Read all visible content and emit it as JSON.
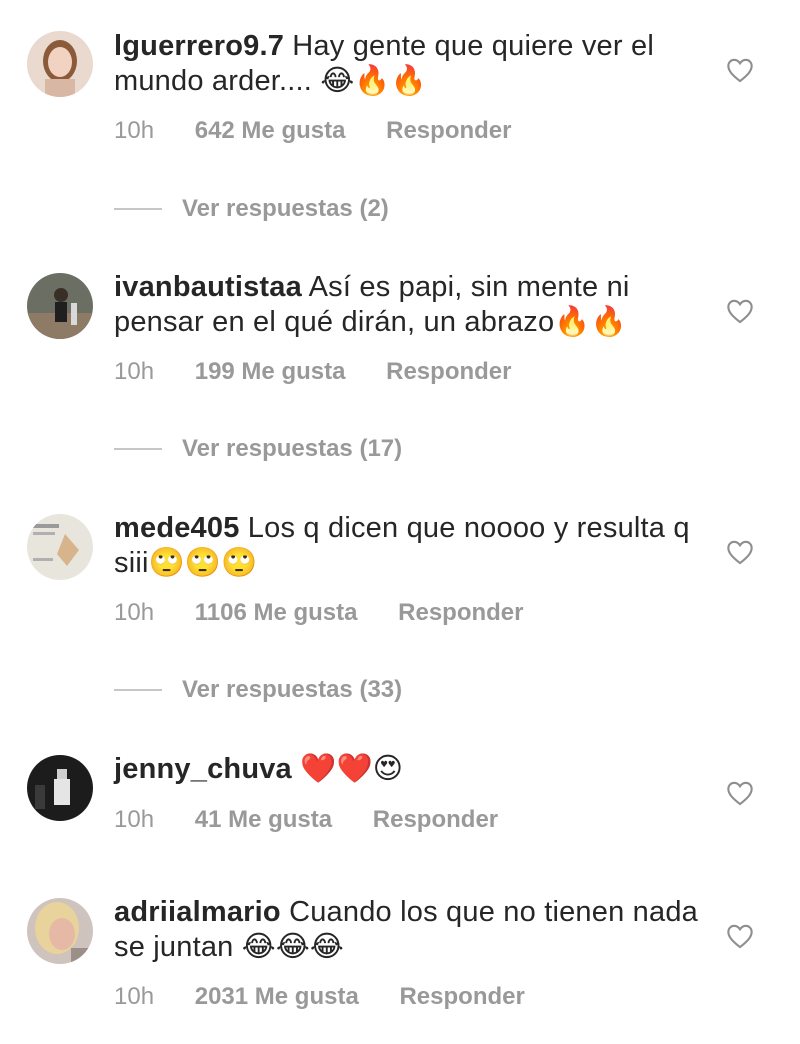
{
  "comments": [
    {
      "username": "lguerrero9.7",
      "text": " Hay gente que quiere ver el mundo arder.... 😂🔥🔥",
      "time": "10h",
      "likes": "642 Me gusta",
      "reply": "Responder",
      "replies_label": "Ver respuestas (2)"
    },
    {
      "username": "ivanbautistaa",
      "text": " Así es papi, sin mente ni pensar en el qué dirán, un abrazo🔥🔥",
      "time": "10h",
      "likes": "199 Me gusta",
      "reply": "Responder",
      "replies_label": "Ver respuestas (17)"
    },
    {
      "username": "mede405",
      "text": " Los q dicen que noooo y resulta q siii🙄🙄🙄",
      "time": "10h",
      "likes": "1106 Me gusta",
      "reply": "Responder",
      "replies_label": "Ver respuestas (33)"
    },
    {
      "username": "jenny_chuva",
      "text": " ❤️❤️😍",
      "time": "10h",
      "likes": "41 Me gusta",
      "reply": "Responder"
    },
    {
      "username": "adriialmario",
      "text": " Cuando los que no tienen nada se juntan 😂😂😂",
      "time": "10h",
      "likes": "2031 Me gusta",
      "reply": "Responder"
    }
  ],
  "icons": {
    "like": "heart-outline-icon"
  },
  "colors": {
    "text": "#262626",
    "meta": "#999999",
    "divider": "#c7c7c7"
  }
}
